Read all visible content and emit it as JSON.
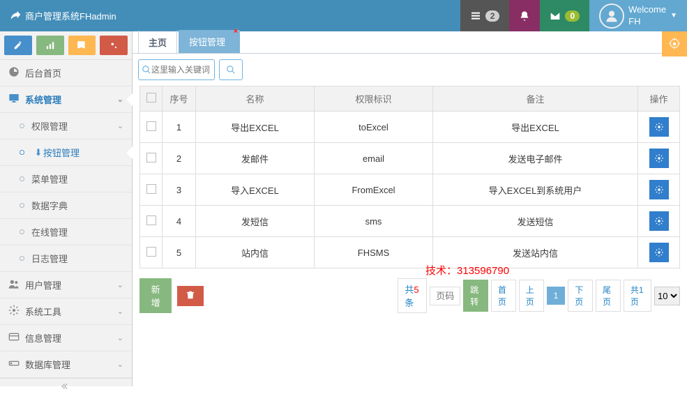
{
  "header": {
    "brand": "商户管理系统FHadmin",
    "notification_count": "2",
    "mail_count": "0",
    "welcome_label": "Welcome",
    "user_name": "FH"
  },
  "sidebar": {
    "items": [
      {
        "label": "后台首页",
        "chev": ""
      },
      {
        "label": "系统管理",
        "chev": "⌄"
      },
      {
        "label": "权限管理",
        "chev": "⌄"
      },
      {
        "label": "按钮管理",
        "chev": ""
      },
      {
        "label": "菜单管理",
        "chev": ""
      },
      {
        "label": "数据字典",
        "chev": ""
      },
      {
        "label": "在线管理",
        "chev": ""
      },
      {
        "label": "日志管理",
        "chev": ""
      },
      {
        "label": "用户管理",
        "chev": "⌄"
      },
      {
        "label": "系统工具",
        "chev": "⌄"
      },
      {
        "label": "信息管理",
        "chev": "⌄"
      },
      {
        "label": "数据库管理",
        "chev": "⌄"
      }
    ]
  },
  "tabs": {
    "home": "主页",
    "active": "按钮管理"
  },
  "search": {
    "placeholder": "这里输入关键词"
  },
  "table": {
    "headers": {
      "seq": "序号",
      "name": "名称",
      "auth": "权限标识",
      "remark": "备注",
      "op": "操作"
    },
    "rows": [
      {
        "seq": "1",
        "name": "导出EXCEL",
        "auth": "toExcel",
        "remark": "导出EXCEL"
      },
      {
        "seq": "2",
        "name": "发邮件",
        "auth": "email",
        "remark": "发送电子邮件"
      },
      {
        "seq": "3",
        "name": "导入EXCEL",
        "auth": "FromExcel",
        "remark": "导入EXCEL到系统用户"
      },
      {
        "seq": "4",
        "name": "发短信",
        "auth": "sms",
        "remark": "发送短信"
      },
      {
        "seq": "5",
        "name": "站内信",
        "auth": "FHSMS",
        "remark": "发送站内信"
      }
    ]
  },
  "footer": {
    "add": "新增",
    "watermark": "技术：313596790",
    "count_prefix": "共",
    "count_num": "5",
    "count_suffix": "条",
    "page_placeholder": "页码",
    "jump": "跳转",
    "first": "首页",
    "prev": "上页",
    "current": "1",
    "next": "下页",
    "last": "尾页",
    "total_pages": "共1页",
    "per_page": "10"
  }
}
